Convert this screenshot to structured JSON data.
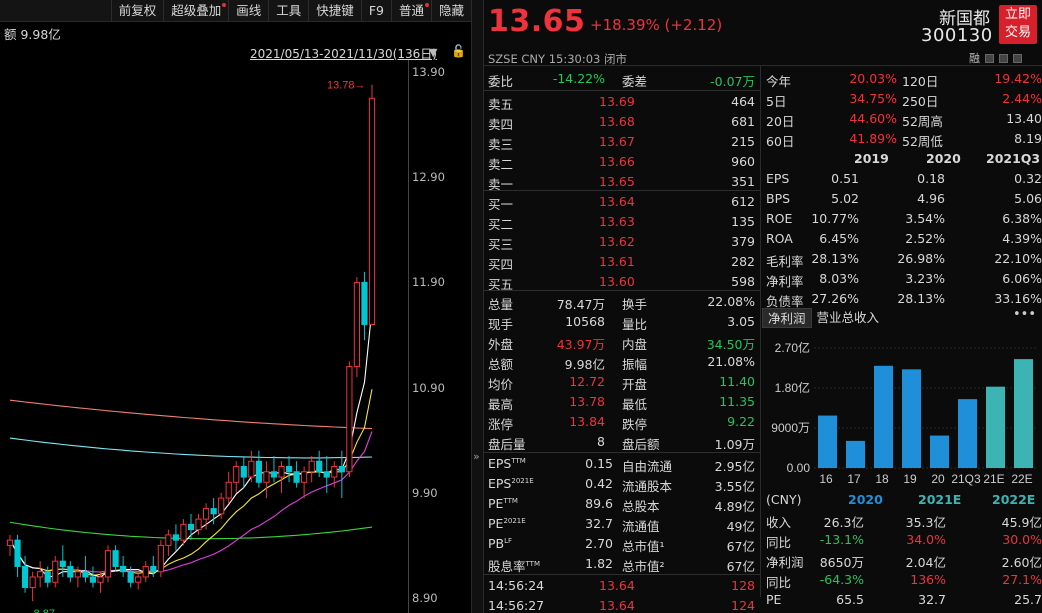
{
  "toolbar": {
    "items": [
      "前复权",
      "超级叠加",
      "画线",
      "工具",
      "快捷键",
      "F9",
      "普通",
      "隐藏"
    ]
  },
  "chart": {
    "amount_label": "额 9.98亿",
    "date_range": "2021/05/13-2021/11/30(136日)",
    "y_ticks": [
      "13.90",
      "12.90",
      "11.90",
      "10.90",
      "9.90",
      "8.90"
    ],
    "y_min": 8.9,
    "y_max": 13.9,
    "high_label": "13.78",
    "low_label": "8.87",
    "colors": {
      "up": "#f0323c",
      "down": "#00c8d2",
      "ma5": "#ffffff",
      "ma10": "#f5e636",
      "ma20": "#e040e0",
      "ma30": "#39d63a",
      "ma60": "#7ee7f5",
      "ma120": "#f08070"
    }
  },
  "chart_data": {
    "type": "candlestick",
    "note_range": "2021/05/13-2021/11/30",
    "candles": [
      [
        9.4,
        9.5,
        9.3,
        9.45
      ],
      [
        9.45,
        9.5,
        9.1,
        9.2
      ],
      [
        9.2,
        9.3,
        8.95,
        9.0
      ],
      [
        9.0,
        9.15,
        8.87,
        9.1
      ],
      [
        9.1,
        9.25,
        9.0,
        9.15
      ],
      [
        9.15,
        9.2,
        9.0,
        9.05
      ],
      [
        9.05,
        9.3,
        9.0,
        9.25
      ],
      [
        9.25,
        9.4,
        9.1,
        9.2
      ],
      [
        9.2,
        9.25,
        9.05,
        9.1
      ],
      [
        9.1,
        9.2,
        9.0,
        9.15
      ],
      [
        9.15,
        9.3,
        9.05,
        9.1
      ],
      [
        9.1,
        9.2,
        9.0,
        9.05
      ],
      [
        9.05,
        9.15,
        8.95,
        9.1
      ],
      [
        9.1,
        9.4,
        9.05,
        9.35
      ],
      [
        9.35,
        9.4,
        9.15,
        9.2
      ],
      [
        9.2,
        9.3,
        9.1,
        9.15
      ],
      [
        9.15,
        9.2,
        9.0,
        9.05
      ],
      [
        9.05,
        9.15,
        8.98,
        9.1
      ],
      [
        9.1,
        9.25,
        9.05,
        9.2
      ],
      [
        9.2,
        9.3,
        9.1,
        9.15
      ],
      [
        9.15,
        9.45,
        9.1,
        9.4
      ],
      [
        9.4,
        9.55,
        9.3,
        9.5
      ],
      [
        9.5,
        9.6,
        9.35,
        9.45
      ],
      [
        9.45,
        9.65,
        9.4,
        9.6
      ],
      [
        9.6,
        9.7,
        9.45,
        9.55
      ],
      [
        9.55,
        9.7,
        9.5,
        9.65
      ],
      [
        9.65,
        9.8,
        9.55,
        9.75
      ],
      [
        9.75,
        9.85,
        9.6,
        9.7
      ],
      [
        9.7,
        9.9,
        9.65,
        9.85
      ],
      [
        9.85,
        10.1,
        9.8,
        10.0
      ],
      [
        10.0,
        10.2,
        9.9,
        10.15
      ],
      [
        10.15,
        10.25,
        9.95,
        10.05
      ],
      [
        10.05,
        10.3,
        10.0,
        10.2
      ],
      [
        10.2,
        10.3,
        9.95,
        10.0
      ],
      [
        10.0,
        10.2,
        9.85,
        10.1
      ],
      [
        10.1,
        10.25,
        10.0,
        10.05
      ],
      [
        10.05,
        10.2,
        9.9,
        10.15
      ],
      [
        10.15,
        10.25,
        10.0,
        10.1
      ],
      [
        10.1,
        10.2,
        9.95,
        10.0
      ],
      [
        10.0,
        10.15,
        9.85,
        10.1
      ],
      [
        10.1,
        10.25,
        10.0,
        10.2
      ],
      [
        10.2,
        10.3,
        10.05,
        10.1
      ],
      [
        10.1,
        10.25,
        9.9,
        10.05
      ],
      [
        10.05,
        10.2,
        9.95,
        10.15
      ],
      [
        10.15,
        10.3,
        9.85,
        10.1
      ],
      [
        10.1,
        11.15,
        10.05,
        11.1
      ],
      [
        11.1,
        11.95,
        11.0,
        11.9
      ],
      [
        11.9,
        12.0,
        11.35,
        11.5
      ],
      [
        11.5,
        13.78,
        11.5,
        13.65
      ]
    ],
    "y_range": [
      8.9,
      13.9
    ]
  },
  "quote": {
    "price": "13.65",
    "change": "+18.39% (+2.12)",
    "meta": "SZSE   CNY   15:30:03   闭市",
    "name": "新国都",
    "code": "300130",
    "trade_btn": [
      "立即",
      "交易"
    ],
    "rz": "融",
    "wb": {
      "l1": "委比",
      "v1": "-14.22%",
      "l2": "委差",
      "v2": "-0.07万"
    },
    "asks": [
      [
        "卖五",
        "13.69",
        "464"
      ],
      [
        "卖四",
        "13.68",
        "681"
      ],
      [
        "卖三",
        "13.67",
        "215"
      ],
      [
        "卖二",
        "13.66",
        "960"
      ],
      [
        "卖一",
        "13.65",
        "351"
      ]
    ],
    "bids": [
      [
        "买一",
        "13.64",
        "612"
      ],
      [
        "买二",
        "13.63",
        "135"
      ],
      [
        "买三",
        "13.62",
        "379"
      ],
      [
        "买四",
        "13.61",
        "282"
      ],
      [
        "买五",
        "13.60",
        "598"
      ]
    ],
    "stats": [
      [
        "总量",
        "78.47万",
        "white",
        "换手",
        "22.08%",
        "white"
      ],
      [
        "现手",
        "10568",
        "white",
        "量比",
        "3.05",
        "white"
      ],
      [
        "外盘",
        "43.97万",
        "red",
        "内盘",
        "34.50万",
        "green"
      ],
      [
        "总额",
        "9.98亿",
        "white",
        "振幅",
        "21.08%",
        "white"
      ],
      [
        "均价",
        "12.72",
        "red",
        "开盘",
        "11.40",
        "green"
      ],
      [
        "最高",
        "13.78",
        "red",
        "最低",
        "11.35",
        "green"
      ],
      [
        "涨停",
        "13.84",
        "red",
        "跌停",
        "9.22",
        "green"
      ],
      [
        "盘后量",
        "8",
        "white",
        "盘后额",
        "1.09万",
        "white"
      ]
    ],
    "funda": [
      [
        "EPS",
        "TTM",
        "0.15",
        "自由流通",
        "2.95亿"
      ],
      [
        "EPS",
        "2021E",
        "0.42",
        "流通股本",
        "3.55亿"
      ],
      [
        "PE",
        "TTM",
        "89.6",
        "总股本",
        "4.89亿"
      ],
      [
        "PE",
        "2021E",
        "32.7",
        "流通值",
        "49亿"
      ],
      [
        "PB",
        "LF",
        "2.70",
        "总市值¹",
        "67亿"
      ],
      [
        "股息率",
        "TTM",
        "1.82",
        "总市值²",
        "67亿"
      ]
    ],
    "ticks": [
      [
        "14:56:24",
        "13.64",
        "128"
      ],
      [
        "14:56:27",
        "13.64",
        "124"
      ]
    ]
  },
  "fin": {
    "perf": [
      [
        "今年",
        "20.03%",
        "120日",
        "19.42%"
      ],
      [
        "5日",
        "34.75%",
        "250日",
        "2.44%"
      ],
      [
        "20日",
        "44.60%",
        "52周高",
        "13.40"
      ],
      [
        "60日",
        "41.89%",
        "52周低",
        "8.19"
      ]
    ],
    "perf_colors": [
      "red",
      "red",
      "white",
      "white"
    ],
    "hdr": [
      "2019",
      "2020",
      "2021Q3"
    ],
    "rows": [
      [
        "EPS",
        "0.51",
        "0.18",
        "0.32"
      ],
      [
        "BPS",
        "5.02",
        "4.96",
        "5.06"
      ],
      [
        "ROE",
        "10.77%",
        "3.54%",
        "6.38%"
      ],
      [
        "ROA",
        "6.45%",
        "2.52%",
        "4.39%"
      ],
      [
        "毛利率",
        "28.13%",
        "26.98%",
        "22.10%"
      ],
      [
        "净利率",
        "8.03%",
        "3.23%",
        "6.06%"
      ],
      [
        "负债率",
        "27.26%",
        "28.13%",
        "33.16%"
      ]
    ],
    "tabs": [
      "净利润",
      "营业总收入"
    ],
    "more": "•••",
    "bar_ticks": [
      "2.70亿",
      "1.80亿",
      "9000万",
      "0.00"
    ],
    "bar_cats": [
      "16",
      "17",
      "18",
      "19",
      "20",
      "21Q3",
      "21E",
      "22E"
    ],
    "bar_values": [
      1.18,
      0.61,
      2.3,
      2.22,
      0.73,
      1.55,
      1.83,
      2.45
    ],
    "bar_max": 2.7,
    "bar_colors": [
      "#1e8fd8",
      "#1e8fd8",
      "#1e8fd8",
      "#1e8fd8",
      "#1e8fd8",
      "#1e8fd8",
      "#3cb4b4",
      "#3cb4b4"
    ],
    "table_hdr": [
      "(CNY)",
      "2020",
      "2021E",
      "2022E"
    ],
    "table": [
      [
        "收入",
        "26.3亿",
        "35.3亿",
        "45.9亿",
        "white",
        "white",
        "white"
      ],
      [
        "同比",
        "-13.1%",
        "34.0%",
        "30.0%",
        "green",
        "red",
        "red"
      ],
      [
        "净利润",
        "8650万",
        "2.04亿",
        "2.60亿",
        "white",
        "white",
        "white"
      ],
      [
        "同比",
        "-64.3%",
        "136%",
        "27.1%",
        "green",
        "red",
        "red"
      ],
      [
        "PE",
        "65.5",
        "32.7",
        "25.7",
        "white",
        "white",
        "white"
      ]
    ]
  }
}
